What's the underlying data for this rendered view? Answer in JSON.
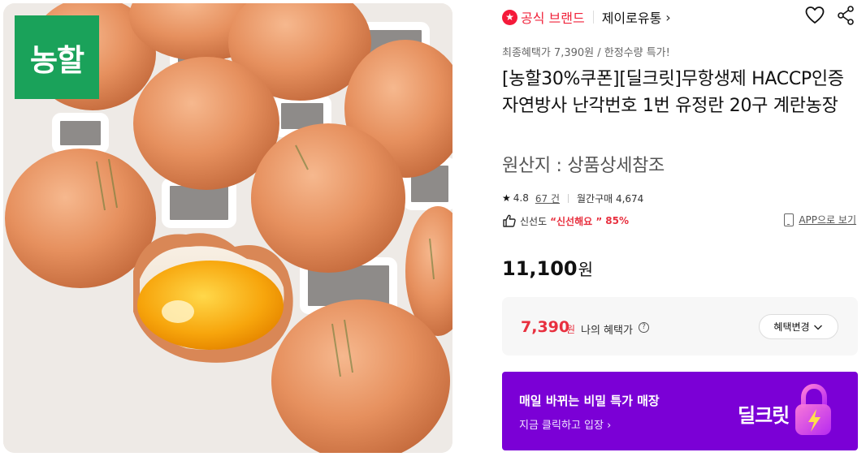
{
  "image": {
    "logo_text": "농할",
    "accent": "#1aa25a"
  },
  "brand": {
    "official_label": "공식 브랜드",
    "seller_name": "제이로유통",
    "chevron": "›",
    "badge_icon": "star-icon",
    "color": "#f0233b"
  },
  "promo_text": "최종혜택가 7,390원 / 한정수량 특가!",
  "product": {
    "title": "[농할30%쿠폰][딜크릿]무항생제 HACCP인증 자연방사 난각번호 1번 유정란 20구 계란농장",
    "origin": "원산지 : 상품상세참조"
  },
  "stats": {
    "rating": "4.8",
    "review_count": "67 건",
    "monthly_purchase": "월간구매 4,674"
  },
  "freshness": {
    "label": "신선도",
    "quote": "“신선해요 ”",
    "percent": "85%",
    "app_link": "APP으로 보기"
  },
  "price": {
    "value": "11,100",
    "unit": "원"
  },
  "benefit": {
    "price": "7,390",
    "unit": "원",
    "label": "나의 혜택가",
    "info_symbol": "?",
    "change_button": "혜택변경"
  },
  "banner": {
    "title": "매일 바뀌는 비밀 특가 매장",
    "subtitle": "지금 클릭하고 입장 ›",
    "logo_text": "딜크릿",
    "background": "#7b00d6"
  }
}
